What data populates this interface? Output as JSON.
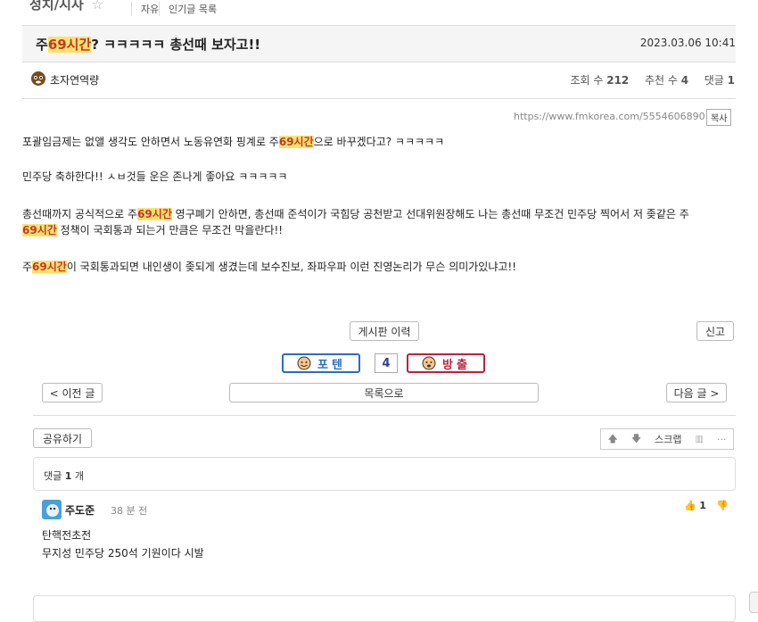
{
  "board": {
    "name": "정치/시사",
    "star": "☆",
    "tabs": [
      "자유",
      "인기글 목록"
    ]
  },
  "post": {
    "title_prefix": "주",
    "title_hl": "69시간",
    "title_suffix": "? ㅋㅋㅋㅋㅋ 총선때 보자고!!",
    "date": "2023.03.06 10:41",
    "author": "초자연역량",
    "views_label": "조회 수",
    "views": "212",
    "recommend_label": "추천 수",
    "recommend": "4",
    "comments_label": "댓글",
    "comments": "1",
    "url": "https://www.fmkorea.com/5554606890",
    "copy_label": "복사"
  },
  "body": {
    "l1_a": "포괄임금제는 없앨 생각도 안하면서 노동유연화 핑계로  주",
    "l1_hl": "69시간",
    "l1_b": "으로 바꾸겠다고? ㅋㅋㅋㅋㅋ",
    "l2": "민주당 축하한다!!  ㅅㅂ것들 운은 존나게 좋아요 ㅋㅋㅋㅋㅋ",
    "l3_a": "총선때까지 공식적으로 주",
    "l3_hl": "69시간",
    "l3_b": " 영구폐기 안하면,  총선때 준석이가 국힘당 공천받고 선대위원장해도 나는 총선때 무조건 민주당 찍어서 저 좆같은 주",
    "l4_hl": "69시간",
    "l4_b": " 정책이 국회통과 되는거 만큼은 무조건 막을란다!!",
    "l5_a": "주",
    "l5_hl": "69시간",
    "l5_b": "이 국회통과되면 내인생이 좆되게 생겼는데 보수진보, 좌파우파 이런 진영논리가 무슨 의미가있냐고!!"
  },
  "actions": {
    "history": "게시판 이력",
    "report": "신고",
    "poten": "포텐",
    "vote_count": "4",
    "banish": "방출",
    "prev": "< 이전 글",
    "list": "목록으로",
    "next": "다음 글 >",
    "share": "공유하기",
    "scrap": "스크랩",
    "more": "···"
  },
  "comments_section": {
    "count_prefix": "댓글",
    "count": "1",
    "count_suffix": "개",
    "items": [
      {
        "author": "주도준",
        "time": "38 분 전",
        "likes": "1",
        "lines": [
          "탄핵전초전",
          "무지성 민주당 250석 기원이다 시발"
        ]
      }
    ]
  },
  "colors": {
    "highlight_bg": "#ffe16b",
    "highlight_fg": "#c0392b",
    "poten": "#2b6cc4",
    "banish": "#c0213a"
  }
}
